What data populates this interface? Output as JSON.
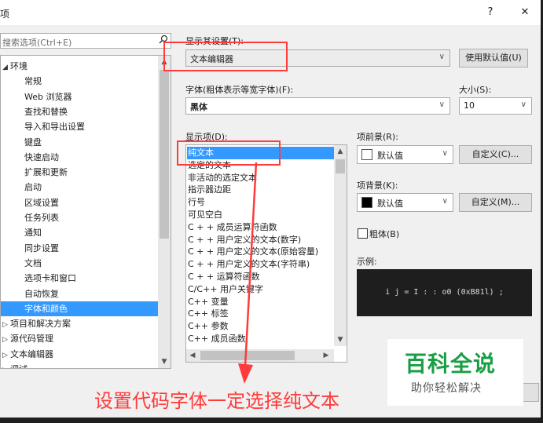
{
  "dialog": {
    "title": "项",
    "help_label": "?",
    "close_label": "✕"
  },
  "search": {
    "placeholder": "搜索选项(Ctrl+E)"
  },
  "tree": {
    "items": [
      {
        "label": "环境",
        "arrow": "◢"
      },
      {
        "label": "常规"
      },
      {
        "label": "Web 浏览器"
      },
      {
        "label": "查找和替换"
      },
      {
        "label": "导入和导出设置"
      },
      {
        "label": "键盘"
      },
      {
        "label": "快速启动"
      },
      {
        "label": "扩展和更新"
      },
      {
        "label": "启动"
      },
      {
        "label": "区域设置"
      },
      {
        "label": "任务列表"
      },
      {
        "label": "通知"
      },
      {
        "label": "同步设置"
      },
      {
        "label": "文档"
      },
      {
        "label": "选项卡和窗口"
      },
      {
        "label": "自动恢复"
      },
      {
        "label": "字体和颜色",
        "selected": true
      },
      {
        "label": "项目和解决方案",
        "arrow": "▷"
      },
      {
        "label": "源代码管理",
        "arrow": "▷"
      },
      {
        "label": "文本编辑器",
        "arrow": "▷"
      },
      {
        "label": "调试",
        "arrow": "▷"
      }
    ]
  },
  "settings": {
    "show_settings_label": "显示其设置(T):",
    "show_settings_value": "文本编辑器",
    "use_defaults_label": "使用默认值(U)",
    "font_label": "字体(粗体表示等宽字体)(F):",
    "font_value": "黑体",
    "size_label": "大小(S):",
    "size_value": "10",
    "display_items_label": "显示项(D):",
    "display_items": [
      "纯文本",
      "选定的文本",
      "非活动的选定文本",
      "指示器边距",
      "行号",
      "可见空白",
      "C + + 成员运算符函数",
      "C + + 用户定义的文本(数字)",
      "C + + 用户定义的文本(原始容量)",
      "C + + 用户定义的文本(字符串)",
      "C + + 运算符函数",
      "C/C++ 用户关键字",
      "C++ 变量",
      "C++ 标签",
      "C++ 参数",
      "C++ 成员函数"
    ],
    "item_foreground_label": "项前景(R):",
    "item_foreground_value": "默认值",
    "item_foreground_swatch": "#ffffff",
    "custom_fg_label": "自定义(C)...",
    "item_background_label": "项背景(K):",
    "item_background_value": "默认值",
    "item_background_swatch": "#000000",
    "custom_bg_label": "自定义(M)...",
    "bold_label": "粗体(B)",
    "sample_label": "示例:",
    "sample_text": "i j = I : : o0 (0xB81l) ;"
  },
  "annotation": {
    "text": "设置代码字体一定选择纯文本",
    "color": "#ff3b3b"
  },
  "watermark": {
    "title": "百科全说",
    "subtitle": "助你轻松解决",
    "color": "#1a9e44"
  }
}
